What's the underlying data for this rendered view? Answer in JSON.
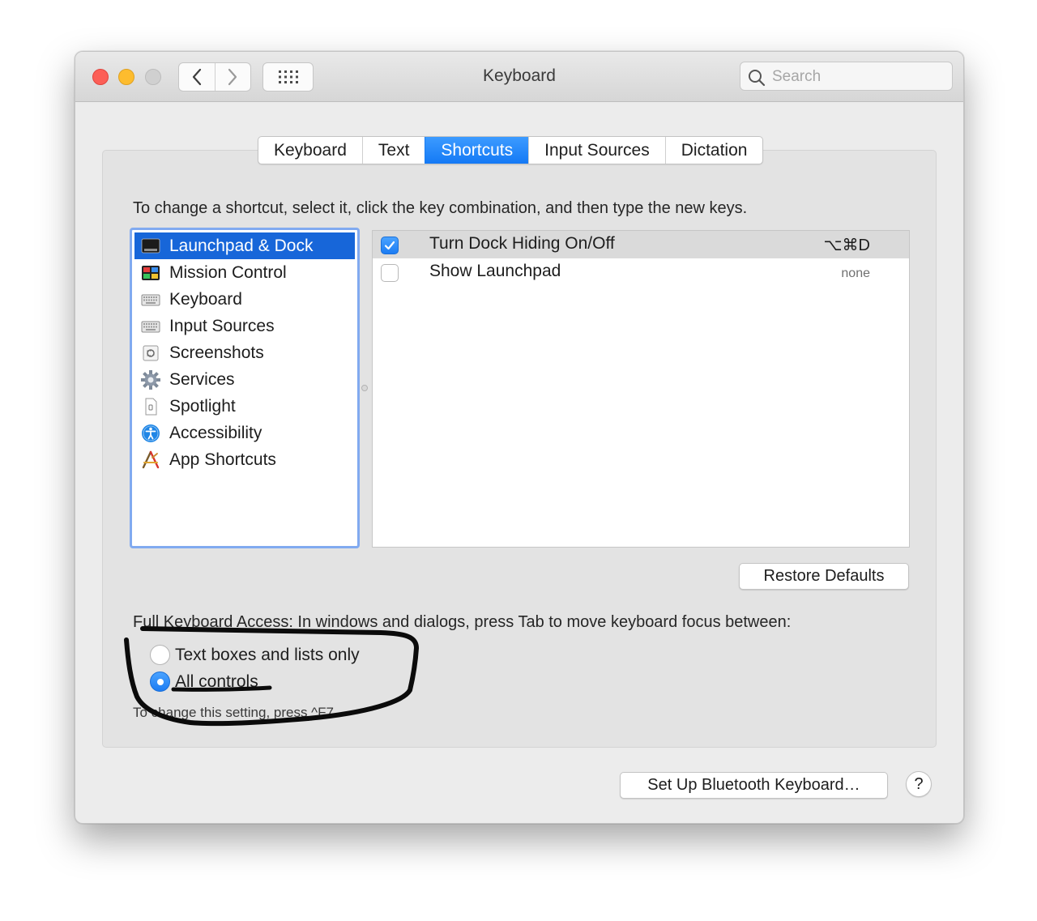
{
  "window": {
    "title": "Keyboard",
    "search_placeholder": "Search"
  },
  "tabs": [
    {
      "label": "Keyboard",
      "active": false
    },
    {
      "label": "Text",
      "active": false
    },
    {
      "label": "Shortcuts",
      "active": true
    },
    {
      "label": "Input Sources",
      "active": false
    },
    {
      "label": "Dictation",
      "active": false
    }
  ],
  "shortcuts": {
    "instruction": "To change a shortcut, select it, click the key combination, and then type the new keys.",
    "categories": [
      {
        "label": "Launchpad & Dock",
        "icon": "launchpad-dock-icon",
        "selected": true
      },
      {
        "label": "Mission Control",
        "icon": "mission-control-icon"
      },
      {
        "label": "Keyboard",
        "icon": "keyboard-icon"
      },
      {
        "label": "Input Sources",
        "icon": "input-sources-icon"
      },
      {
        "label": "Screenshots",
        "icon": "screenshots-icon"
      },
      {
        "label": "Services",
        "icon": "services-gear-icon"
      },
      {
        "label": "Spotlight",
        "icon": "spotlight-icon"
      },
      {
        "label": "Accessibility",
        "icon": "accessibility-icon"
      },
      {
        "label": "App Shortcuts",
        "icon": "app-shortcuts-icon"
      }
    ],
    "items": [
      {
        "name": "Turn Dock Hiding On/Off",
        "keys": "⌥⌘D",
        "checked": true,
        "selected": true
      },
      {
        "name": "Show Launchpad",
        "keys": "none",
        "checked": false,
        "selected": false
      }
    ],
    "restore_defaults": "Restore Defaults"
  },
  "full_keyboard_access": {
    "label": "Full Keyboard Access: In windows and dialogs, press Tab to move keyboard focus between:",
    "options": [
      {
        "label": "Text boxes and lists only",
        "selected": false
      },
      {
        "label": "All controls",
        "selected": true
      }
    ],
    "hint": "To change this setting, press ^F7."
  },
  "footer": {
    "bluetooth_button": "Set Up Bluetooth Keyboard…",
    "help_button": "?"
  },
  "colors": {
    "accent": "#1479f5",
    "selection": "#1766d9",
    "close": "#fc5f57",
    "minimize": "#fdbc2e",
    "annotation_ink": "#0b0b0b"
  }
}
